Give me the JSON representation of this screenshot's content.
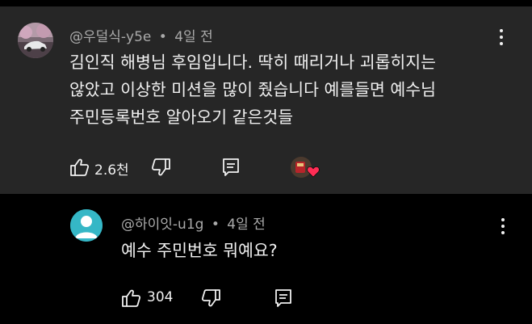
{
  "comment": {
    "handle": "@우덜식-y5e",
    "separator": "•",
    "time": "4일 전",
    "lines": [
      "김인직 해병님 후임입니다. 딱히 때리거나 괴롭히지는",
      "않았고 이상한 미션을 많이 줬습니다 예를들면 예수님",
      "주민등록번호 알아오기 같은것들"
    ],
    "likes": "2.6천"
  },
  "reply": {
    "handle": "@하이잇-u1g",
    "separator": "•",
    "time": "4일 전",
    "text": "예수 주민번호 뭐예요?",
    "likes": "304"
  },
  "icons": {
    "like": "thumbs-up-icon",
    "dislike": "thumbs-down-icon",
    "reply": "reply-comment-icon",
    "more": "more-vert-icon",
    "heart": "creator-heart-icon"
  },
  "colors": {
    "top_bg": "#262626",
    "reply_bg": "#000000",
    "meta": "#aaaaaa",
    "text": "#f1f1f1",
    "heart": "#ff2d55"
  }
}
